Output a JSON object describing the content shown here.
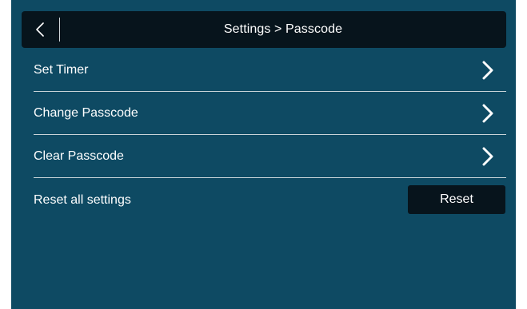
{
  "header": {
    "title": "Settings > Passcode",
    "back_icon": "chevron-left-icon"
  },
  "menu": {
    "items": [
      {
        "label": "Set Timer",
        "icon": "chevron-right-icon"
      },
      {
        "label": "Change Passcode",
        "icon": "chevron-right-icon"
      },
      {
        "label": "Clear Passcode",
        "icon": "chevron-right-icon"
      }
    ]
  },
  "reset": {
    "label": "Reset all settings",
    "button_label": "Reset"
  },
  "colors": {
    "background": "#0e4a63",
    "header_bg": "#07141c",
    "button_bg": "#07141c",
    "text": "#ffffff",
    "separator": "#c9d4d9"
  }
}
